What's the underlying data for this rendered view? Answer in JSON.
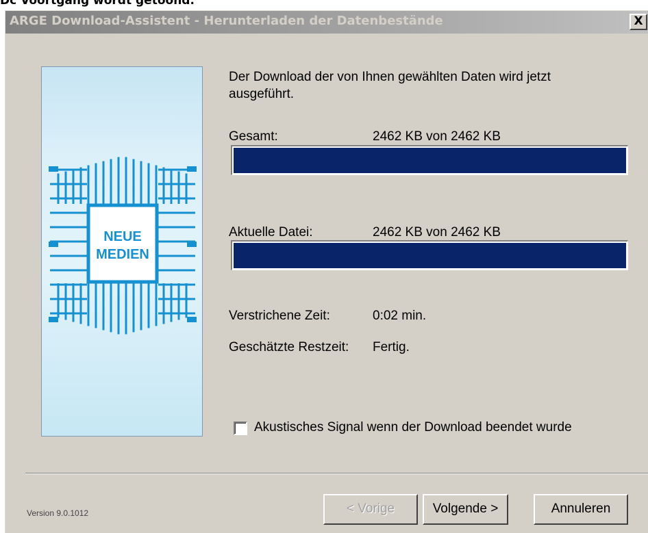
{
  "page_caption": "Dc Voortgang wordt getoond.",
  "window": {
    "title": "ARGE Download-Assistent - Herunterladen der Datenbestände",
    "close_label": "X"
  },
  "banner": {
    "logo_line1": "NEUE",
    "logo_line2": "MEDIEN",
    "gradient_colors": [
      "#c7e5f3",
      "#e2f3fa"
    ],
    "circuit_color": "#1590d0"
  },
  "intro_text": "Der Download der von Ihnen gewählten Daten wird jetzt ausgeführt.",
  "progress": {
    "total": {
      "label": "Gesamt:",
      "value": "2462 KB von 2462 KB",
      "fraction": 1.0
    },
    "current": {
      "label": "Aktuelle Datei:",
      "value": "2462 KB von 2462 KB",
      "fraction": 1.0
    },
    "bar_color": "#0a246a"
  },
  "times": {
    "elapsed_label": "Verstrichene Zeit:",
    "elapsed_value": "0:02 min.",
    "remaining_label": "Geschätzte Restzeit:",
    "remaining_value": "Fertig."
  },
  "checkbox": {
    "label": "Akustisches Signal wenn der Download beendet wurde",
    "checked": false
  },
  "footer": {
    "version": "Version 9.0.1012",
    "prev_label": "< Vorige",
    "next_label": "Volgende >",
    "cancel_label": "Annuleren"
  }
}
